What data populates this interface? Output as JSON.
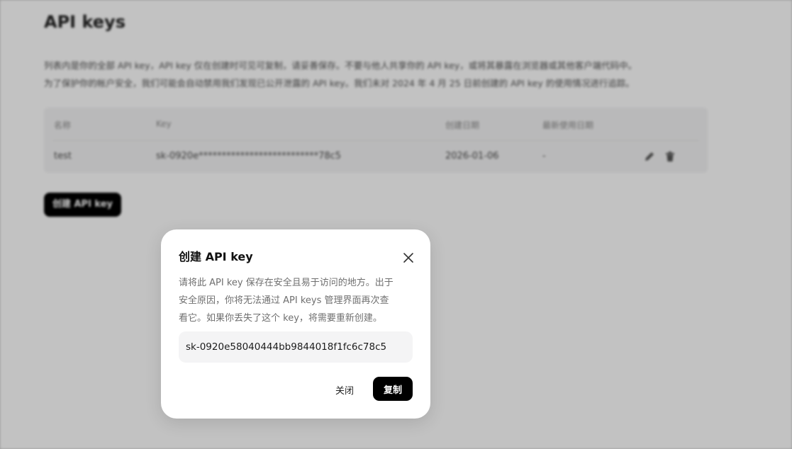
{
  "page": {
    "title": "API keys",
    "description_lines": [
      "列表内是你的全部 API key，API key 仅在创建时可见可复制，请妥善保存。不要与他人共享你的 API key，或将其暴露在浏览器或其他客户端代码中。",
      "为了保护你的帐户安全，我们可能会自动禁用我们发现已公开泄露的 API key。我们未对 2024 年 4 月 25 日前创建的 API key 的使用情况进行追踪。"
    ],
    "table": {
      "headers": [
        "名称",
        "Key",
        "创建日期",
        "最新使用日期"
      ],
      "rows": [
        {
          "name": "test",
          "key": "sk-0920e**************************78c5",
          "created": "2026-01-06",
          "last_used": "-",
          "actions": [
            "edit-icon",
            "trash-icon"
          ]
        }
      ]
    },
    "create_button_label": "创建 API key"
  },
  "modal": {
    "title": "创建 API key",
    "description_lines": [
      "请将此 API key 保存在安全且易于访问的地方。出于",
      "安全原因，你将无法通过 API keys 管理界面再次查",
      "看它。如果你丢失了这个 key，将需要重新创建。"
    ],
    "key_value": "sk-0920e58040444bb9844018f1fc6c78c5",
    "close_label": "关闭",
    "copy_label": "复制",
    "close_icon": "close-icon"
  },
  "colors": {
    "primary_button": "#000000",
    "overlay": "rgba(0,0,0,0.24)",
    "field_background": "#f4f4f5"
  }
}
